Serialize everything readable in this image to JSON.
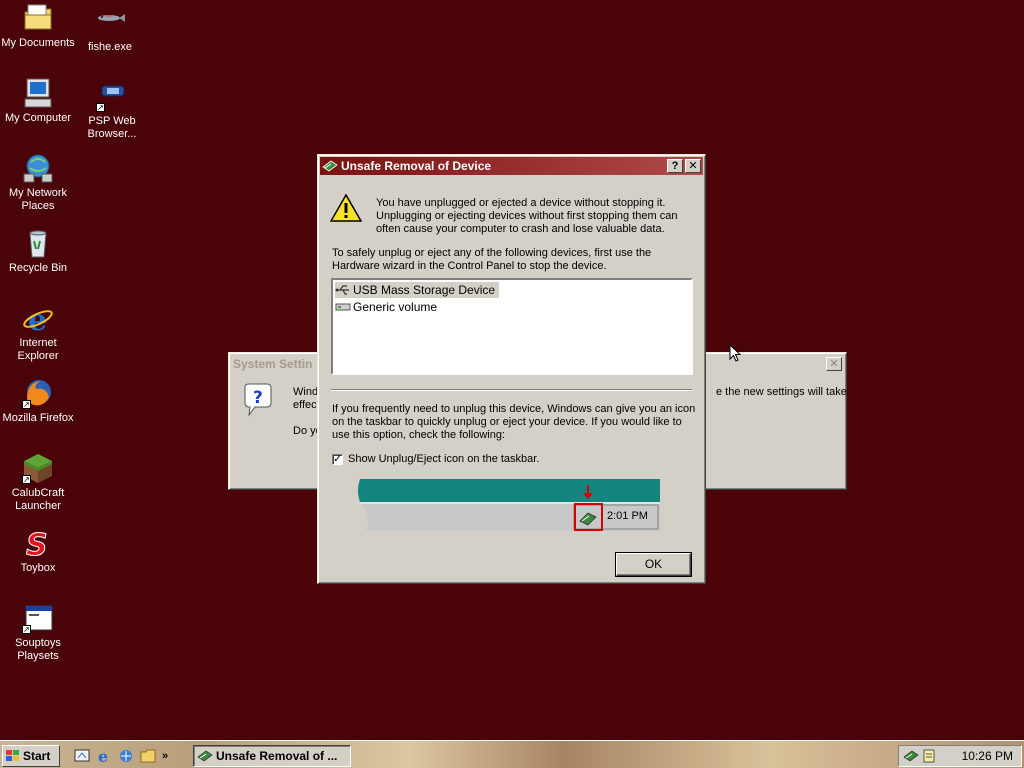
{
  "desktop": {
    "icons": [
      {
        "label": "My Documents"
      },
      {
        "label": "fishe.exe"
      },
      {
        "label": "My Computer"
      },
      {
        "label": "PSP Web Browser..."
      },
      {
        "label": "My Network Places"
      },
      {
        "label": "Recycle Bin"
      },
      {
        "label": "Internet Explorer"
      },
      {
        "label": "Mozilla Firefox"
      },
      {
        "label": "CalubCraft Launcher"
      },
      {
        "label": "Toybox"
      },
      {
        "label": "Souptoys Playsets"
      }
    ]
  },
  "bg_window": {
    "title": "System Settin",
    "text_left_1": "Windo",
    "text_left_2": "effec",
    "text_left_3": "Do yo",
    "text_right": "e the new settings will take"
  },
  "dialog": {
    "title": "Unsafe Removal of Device",
    "help_label": "?",
    "close_label": "✕",
    "warning": "You have unplugged or ejected a device without stopping it. Unplugging or ejecting devices without first stopping them can often cause your computer to crash and lose valuable data.",
    "instructions": "To safely unplug or eject any of the following devices, first use the Hardware wizard in the Control Panel to stop the device.",
    "devices": [
      {
        "label": "USB Mass Storage Device"
      },
      {
        "label": "Generic volume"
      }
    ],
    "info": "If you frequently need to unplug this device, Windows can give you an icon on the taskbar to quickly unplug or eject your device. If you would like to use this option, check the following:",
    "checkbox_label": "Show Unplug/Eject icon on the taskbar.",
    "checkbox_checked": true,
    "preview_time": "2:01 PM",
    "ok_label": "OK"
  },
  "taskbar": {
    "start_label": "Start",
    "task_label": "Unsafe Removal of ...",
    "clock": "10:26 PM",
    "quick_launch": [
      "show-desktop-icon",
      "ie-icon",
      "outlook-icon",
      "folder-icon"
    ]
  },
  "colors": {
    "desktop": "#4a0308",
    "title_active_start": "#7a1111",
    "title_active_end": "#b04b4b",
    "preview_teal": "#13857e",
    "highlight_red": "#d40000"
  }
}
